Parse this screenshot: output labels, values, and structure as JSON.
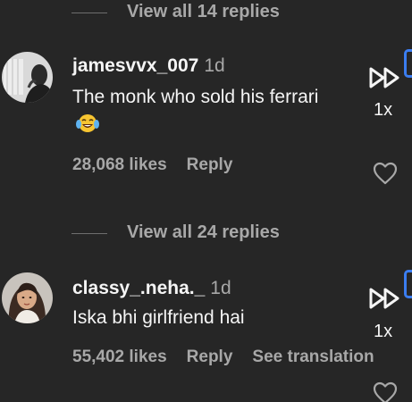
{
  "thread1": {
    "view_replies": "View all 14 replies",
    "username": "jamesvvx_007",
    "time": "1d",
    "text": "The monk who sold his ferrari",
    "emoji_icon": "laughing-tears-emoji",
    "likes": "28,068 likes",
    "reply": "Reply",
    "speed": "1x"
  },
  "thread2": {
    "view_replies": "View all 24 replies",
    "username": "classy_.neha._",
    "time": "1d",
    "text": "Iska bhi girlfriend hai",
    "likes": "55,402 likes",
    "reply": "Reply",
    "translate": "See translation",
    "speed": "1x"
  },
  "icons": {
    "fast_forward": "fast-forward-icon",
    "heart": "heart-icon",
    "avatar": "avatar"
  },
  "colors": {
    "background": "#262626",
    "primary_text": "#f5f5f5",
    "secondary_text": "#a8a8a8",
    "badge_blue": "#3b7df0"
  }
}
